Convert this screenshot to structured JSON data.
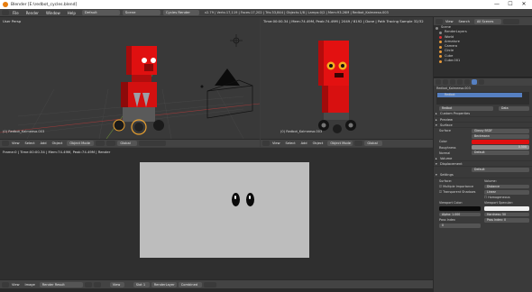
{
  "window": {
    "title": "Blender [E:\\redbot_cycles.blend]",
    "minimize": "—",
    "maximize": "☐",
    "close": "✕"
  },
  "topbar": {
    "menus": [
      "File",
      "Render",
      "Window",
      "Help"
    ],
    "layout": "Default",
    "scene": "Scene",
    "engine": "Cycles Render",
    "info": "v2.79 | Verts:17,119 | Faces:17,202 | Tris:33,844 | Objects:1/8 | Lamps:0/2 | Mem:93.26M | Redbot_Kalmeesa.003"
  },
  "viewport_left": {
    "label": "User Persp",
    "object_label": "(0) Redbot_Kalmeesa.003",
    "header": {
      "menus": [
        "View",
        "Select",
        "Add",
        "Object"
      ],
      "mode": "Object Mode",
      "orientation": "Global"
    }
  },
  "viewport_right": {
    "label": "Time:00:00.34 | Mem:74.49M, Peak:74.49M | 2049 / 8192 | Done | Path Tracing Sample 32/32",
    "object_label": "(0) Redbot_Kalmeesa.003",
    "header": {
      "menus": [
        "View",
        "Select",
        "Add",
        "Object"
      ],
      "mode": "Object Mode",
      "orientation": "Global"
    }
  },
  "image_editor": {
    "info": "Frame:0 | Time:00:00.34 | Mem:74.49M, Peak:74.49M | Render",
    "header": {
      "menus": [
        "View",
        "Image"
      ],
      "image": "Render Result",
      "view": "View",
      "slot": "Slot 1",
      "layer": "RenderLayer",
      "pass": "Combined"
    }
  },
  "outliner": {
    "menus": [
      "View",
      "Search",
      "All Scenes"
    ],
    "items": [
      "Scene",
      "RenderLayers",
      "World",
      "Armature",
      "Camera",
      "Circle",
      "Cube",
      "Cube.001"
    ]
  },
  "properties": {
    "breadcrumb": "Redbot_Kalmeesa.003",
    "material_slot": "Redbot",
    "material_name": "Redbot",
    "data_label": "Data",
    "panels_closed": [
      "Preview",
      "Surface",
      "Volume",
      "Displacement"
    ],
    "custom_props": "Custom Properties",
    "surface": {
      "shader_label": "Surface",
      "shader": "Glossy BSDF",
      "distribution_label": "Beckmann",
      "color_label": "Color",
      "roughness_label": "Roughness",
      "roughness": "0.500",
      "normal_label": "Normal",
      "normal": "Default"
    },
    "displacement": {
      "label": "Displacement",
      "value": "Default"
    },
    "settings": {
      "title": "Settings",
      "surface_label": "Surface:",
      "volume_label": "Volume:",
      "mis_label": "Multiple Importance",
      "transparent_label": "Transparent Shadows",
      "sampling": "Distance",
      "interpolation": "Linear",
      "homogeneous": "Homogeneous",
      "viewport_color_label": "Viewport Color:",
      "viewport_specular_label": "Viewport Specular:",
      "alpha_label": "Alpha:",
      "alpha": "1.000",
      "hardness_label": "Hardness:",
      "hardness": "50",
      "pass_index_label": "Pass Index:",
      "pass_index": "0",
      "pass_index_label2": "Pass Index",
      "pass_index_value": "0"
    }
  },
  "colors": {
    "robot_red": "#e01010",
    "robot_dark": "#5a0808",
    "viewport_bg": "#393939",
    "render_bg": "#bdbdbd",
    "accent_blue": "#5680c2"
  }
}
